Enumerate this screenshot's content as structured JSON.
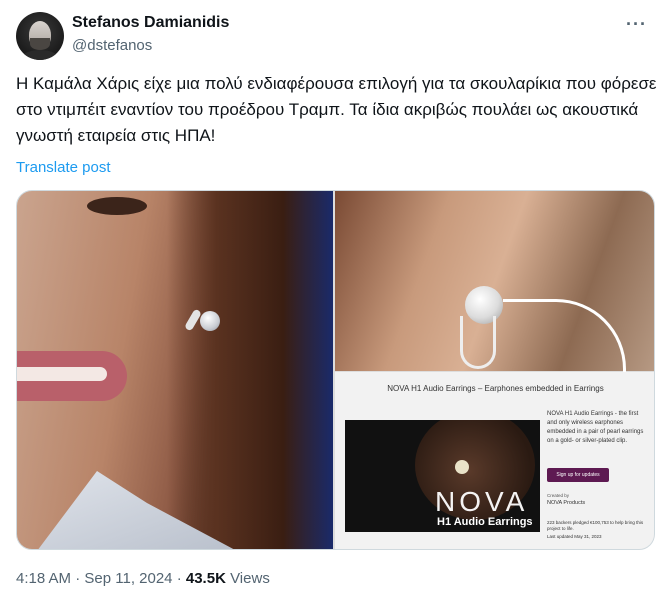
{
  "author": {
    "name": "Stefanos Damianidis",
    "handle": "@dstefanos"
  },
  "more_menu": "···",
  "tweet": {
    "text": "Η Καμάλα Χάρις είχε μια πολύ ενδιαφέρουσα επιλογή για τα σκουλαρίκια που φόρεσε στο ντιμπέιτ εναντίον του προέδρου Τραμπ. Τα ίδια ακριβώς πουλάει ως ακουστικά γνωστή εταιρεία στις ΗΠΑ!",
    "translate_label": "Translate post"
  },
  "media": {
    "product_page": {
      "title": "NOVA H1 Audio Earrings – Earphones embedded in Earrings",
      "logo": "NOVA",
      "logo_sub": "H1 Audio Earrings",
      "description": "NOVA H1 Audio Earrings - the first and only wireless earphones embedded in a pair of pearl earrings on a gold- or silver-plated clip.",
      "button_label": "Sign up for updates",
      "created_by_label": "Created by",
      "company": "NOVA Products",
      "backers": "223 backers pledged €100,753 to help bring this project to life.",
      "last_updated": "Last updated May 31, 2023"
    }
  },
  "meta": {
    "time": "4:18 AM",
    "separator": "·",
    "date": "Sep 11, 2024",
    "dot": "·",
    "views_count": "43.5K",
    "views_label": "Views"
  }
}
